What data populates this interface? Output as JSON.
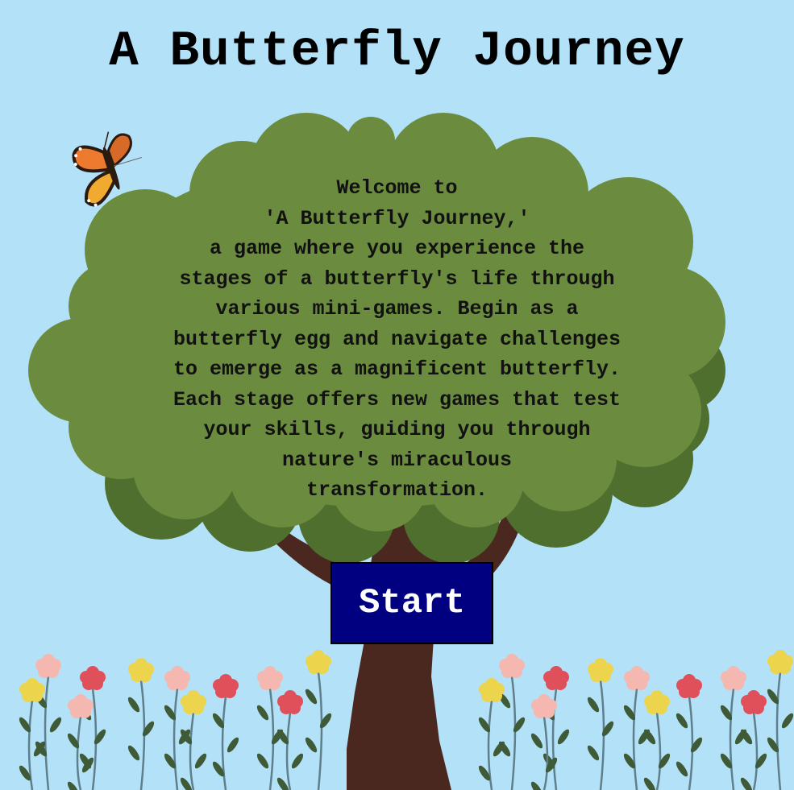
{
  "title": "A Butterfly Journey",
  "intro": {
    "lines": [
      "Welcome to",
      "'A Butterfly Journey,'",
      "a game where you experience the",
      "stages of a butterfly's life through",
      "various mini-games. Begin as a",
      "butterfly egg and navigate challenges",
      "to emerge as a magnificent butterfly.",
      "Each stage offers new games that test",
      "your skills, guiding you through",
      "nature's miraculous",
      "transformation."
    ]
  },
  "start_button": {
    "label": "Start"
  },
  "colors": {
    "sky": "#b3e1f8",
    "foliage": "#6b8c3e",
    "foliage_shadow": "#4f6f2f",
    "trunk": "#4a2820",
    "button": "#000080",
    "flower_pink": "#f4b8b0",
    "flower_red": "#e0505a",
    "flower_yellow": "#ecd44c",
    "stem": "#5f7f8a",
    "leaf": "#3f5a36"
  },
  "icons": {
    "butterfly": "monarch-butterfly-icon",
    "tree": "tree-illustration",
    "flowers": "flower-meadow"
  }
}
